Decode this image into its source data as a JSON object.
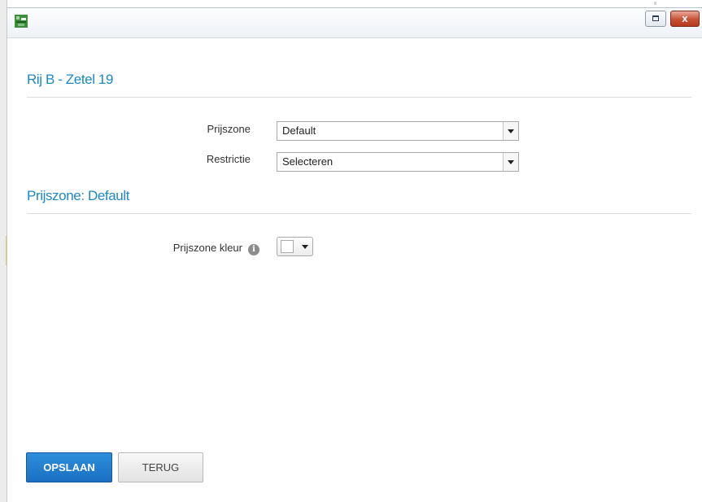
{
  "window": {
    "maximize_label": "",
    "close_label": "x"
  },
  "section1": {
    "title": "Rij B - Zetel 19",
    "fields": [
      {
        "label": "Prijszone",
        "value": "Default"
      },
      {
        "label": "Restrictie",
        "value": "Selecteren"
      }
    ]
  },
  "section2": {
    "title": "Prijszone: Default",
    "color_label": "Prijszone kleur",
    "info_icon": "i",
    "selected_color": "#ffffff"
  },
  "buttons": {
    "save_label": "OPSLAAN",
    "back_label": "TERUG"
  },
  "colors": {
    "accent": "#1e88c7",
    "primary_button": "#1a6fc2",
    "close_button": "#c75135"
  }
}
